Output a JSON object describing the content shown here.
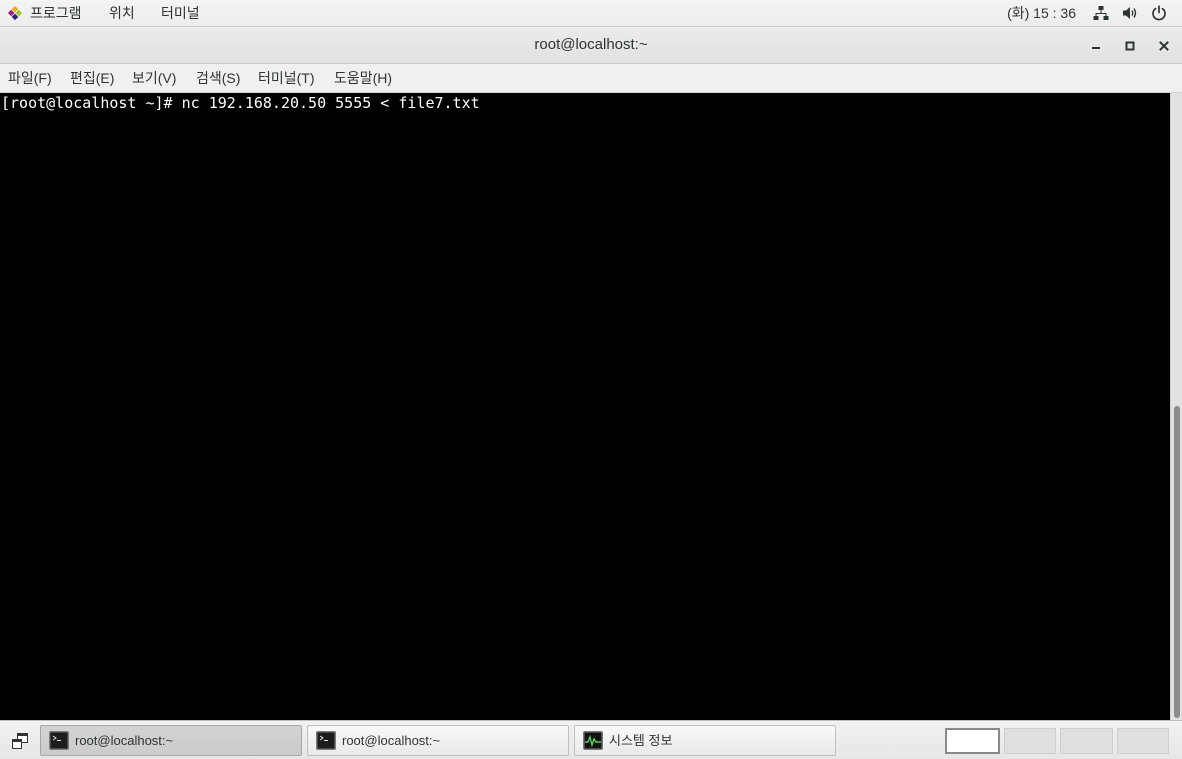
{
  "top_panel": {
    "applications_icon": "centos-logo-icon",
    "menus": [
      "프로그램",
      "위치",
      "터미널"
    ],
    "clock": "(화) 15 : 36",
    "status_icons": [
      "network-icon",
      "volume-icon",
      "power-icon"
    ]
  },
  "window": {
    "title": "root@localhost:~",
    "control_icons": [
      "minimize-icon",
      "maximize-icon",
      "close-icon"
    ]
  },
  "menu_bar": {
    "items": [
      "파일(F)",
      "편집(E)",
      "보기(V)",
      "검색(S)",
      "터미널(T)",
      "도움말(H)"
    ]
  },
  "terminal": {
    "lines": [
      "[root@localhost ~]# nc 192.168.20.50 5555 < file7.txt"
    ],
    "background": "#000000",
    "foreground": "#ffffff",
    "scrollbar": {
      "scroll_fraction": 1.0,
      "visible_fraction": 0.5
    }
  },
  "taskbar": {
    "show_desktop_icon": "show-desktop-icon",
    "windows": [
      {
        "label": "root@localhost:~",
        "icon": "terminal-icon",
        "active": true
      },
      {
        "label": "root@localhost:~",
        "icon": "terminal-icon",
        "active": false
      },
      {
        "label": "시스템 정보",
        "icon": "system-monitor-icon",
        "active": false
      }
    ],
    "workspaces": {
      "count": 4,
      "active_index": 0
    }
  }
}
